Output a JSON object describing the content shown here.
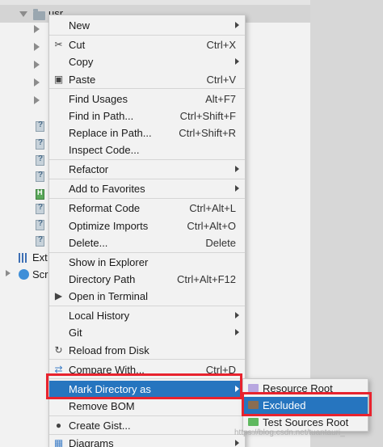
{
  "tree": {
    "root_folder_label": "usr",
    "external_libraries_label": "Ext",
    "scratches_label": "Scr"
  },
  "menu": {
    "items": [
      {
        "label": "New",
        "shortcut": "",
        "submenu": true
      },
      {
        "label": "Cut",
        "shortcut": "Ctrl+X",
        "submenu": false,
        "icon": "scissors-icon"
      },
      {
        "label": "Copy",
        "shortcut": "",
        "submenu": true
      },
      {
        "label": "Paste",
        "shortcut": "Ctrl+V",
        "submenu": false,
        "icon": "clipboard-icon"
      },
      {
        "label": "Find Usages",
        "shortcut": "Alt+F7",
        "submenu": false
      },
      {
        "label": "Find in Path...",
        "shortcut": "Ctrl+Shift+F",
        "submenu": false
      },
      {
        "label": "Replace in Path...",
        "shortcut": "Ctrl+Shift+R",
        "submenu": false
      },
      {
        "label": "Inspect Code...",
        "shortcut": "",
        "submenu": false
      },
      {
        "label": "Refactor",
        "shortcut": "",
        "submenu": true
      },
      {
        "label": "Add to Favorites",
        "shortcut": "",
        "submenu": true
      },
      {
        "label": "Reformat Code",
        "shortcut": "Ctrl+Alt+L",
        "submenu": false
      },
      {
        "label": "Optimize Imports",
        "shortcut": "Ctrl+Alt+O",
        "submenu": false
      },
      {
        "label": "Delete...",
        "shortcut": "Delete",
        "submenu": false
      },
      {
        "label": "Show in Explorer",
        "shortcut": "",
        "submenu": false
      },
      {
        "label": "Directory Path",
        "shortcut": "Ctrl+Alt+F12",
        "submenu": false
      },
      {
        "label": "Open in Terminal",
        "shortcut": "",
        "submenu": false,
        "icon": "terminal-icon"
      },
      {
        "label": "Local History",
        "shortcut": "",
        "submenu": true
      },
      {
        "label": "Git",
        "shortcut": "",
        "submenu": true
      },
      {
        "label": "Reload from Disk",
        "shortcut": "",
        "submenu": false,
        "icon": "reload-icon"
      },
      {
        "label": "Compare With...",
        "shortcut": "Ctrl+D",
        "submenu": false,
        "icon": "compare-icon"
      },
      {
        "label": "Mark Directory as",
        "shortcut": "",
        "submenu": true,
        "highlighted": true
      },
      {
        "label": "Remove BOM",
        "shortcut": "",
        "submenu": false
      },
      {
        "label": "Create Gist...",
        "shortcut": "",
        "submenu": false,
        "icon": "github-icon"
      },
      {
        "label": "Diagrams",
        "shortcut": "",
        "submenu": true,
        "icon": "diagram-icon"
      }
    ]
  },
  "submenu": {
    "items": [
      {
        "label": "Resource Root",
        "color": "#b8a7e0"
      },
      {
        "label": "Excluded",
        "color": "#8a6d52",
        "highlighted": true
      },
      {
        "label": "Test Sources Root",
        "color": "#5fb85f"
      }
    ]
  },
  "colors": {
    "highlight": "#2675bf",
    "annotation_red": "#e8232e"
  },
  "watermark": "https://blog.csdn.net/tuantauri_"
}
